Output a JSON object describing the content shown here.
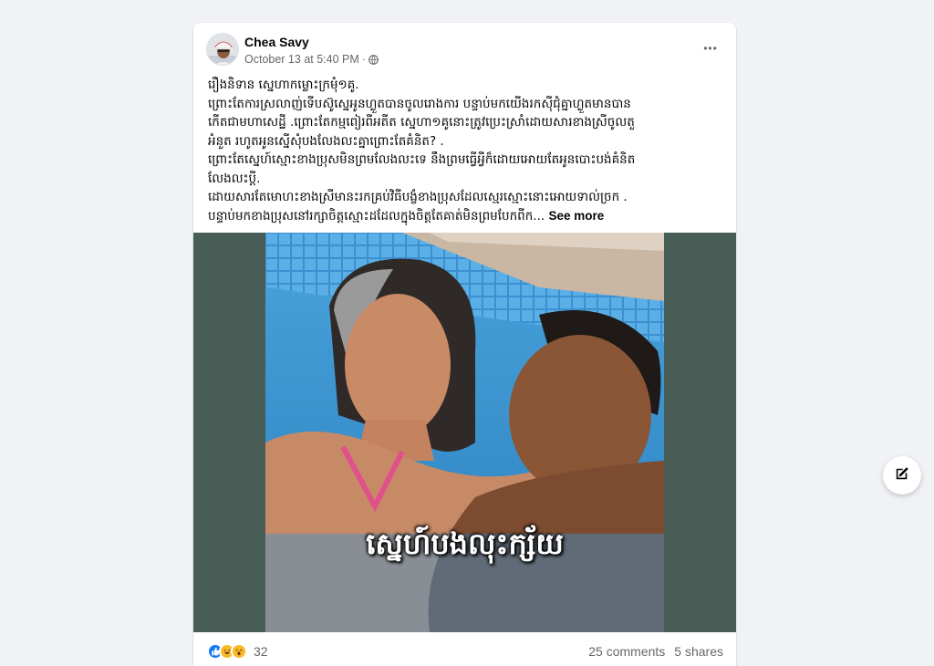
{
  "post": {
    "author": "Chea Savy",
    "timestamp": "October 13 at 5:40 PM",
    "privacy_sep": "·",
    "privacy_icon": "globe-icon",
    "more_label": "•••",
    "text_lines": [
      "រឿងនិទាន   ស្នេហាកម្លោះក្រមុំ១គូ.",
      "ព្រោះតែការស្រលាញ់ទើបស៊ូស្នេអូនហ្លួតបានចូលរោងការ បន្ទាប់មកយើងរកស៊ីជុំគ្នាហ្លួតមានបាន",
      "កើតជាមហាសេដ្ឋី .ព្រោះតែកម្មពៀរពីអតីត ស្នេហា១គូនោះត្រូវប្រេះស្រាំដោយសារខាងស្រីចូលតួ",
      "អំនួត រហូតអូនស្នើសុំបងលែងលះគ្នាព្រោះតែគំនិត? .",
      "ព្រោះតែស្នេហ៍ស្មោះខាងប្រុសមិនព្រមលែងលះទេ នឹងព្រមធ្វើអ្វីក៏ដោយអោយតែអូនបោះបង់គំនិត",
      "លែងលះប្តី.",
      "ដោយសារតែមោហះខាងស្រីមានះរកគ្រប់វិធីបង្ខំខាងប្រុសដែលស្មេរស្មោះនោះអោយទាល់ច្រក .",
      "បន្ទាប់មកខាងប្រុសនៅរក្សាចិត្តស្មោះដដែលក្នុងចិត្តតែគាត់មិនព្រមបែកពីក..."
    ],
    "see_more": "See more",
    "image_caption": "ស្នេហ៍បងលុះក្ស័យ",
    "reaction_count": "32",
    "comments": "25 comments",
    "shares": "5 shares"
  },
  "colors": {
    "background": "#f0f2f5",
    "card": "#ffffff",
    "image_letterbox": "#495d57",
    "like_blue": "#1877f2",
    "haha_yellow": "#f7b928"
  },
  "compose_icon": "edit-icon"
}
